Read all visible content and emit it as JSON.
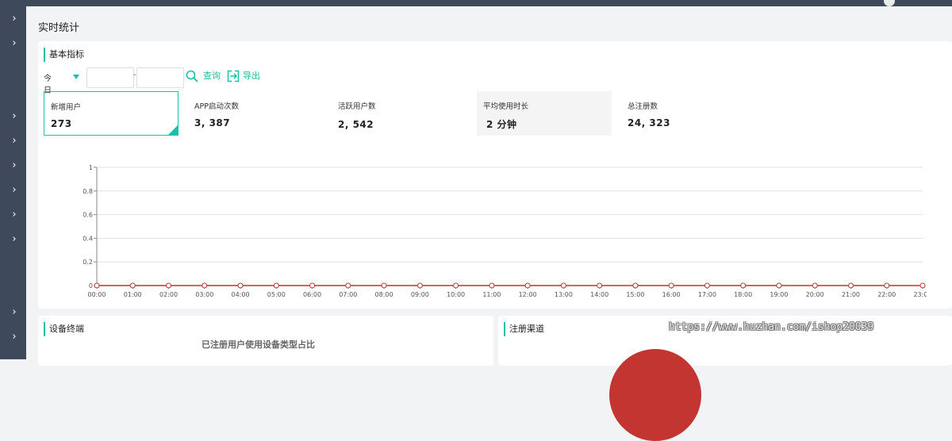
{
  "page_title": "实时统计",
  "basic_section": {
    "title": "基本指标",
    "filter": {
      "range_select": "今日",
      "start_date_value": "",
      "end_date_value": "",
      "separator": "-",
      "query_label": "查询",
      "export_label": "导出"
    },
    "metrics": [
      {
        "label": "新增用户",
        "value": "273",
        "state": "selected"
      },
      {
        "label": "APP启动次数",
        "value": "3, 387",
        "state": "normal"
      },
      {
        "label": "活跃用户数",
        "value": "2, 542",
        "state": "normal"
      },
      {
        "label": "平均使用时长",
        "value": "2 分钟",
        "state": "hover"
      },
      {
        "label": "总注册数",
        "value": "24, 323",
        "state": "normal"
      }
    ]
  },
  "chart_data": {
    "type": "line",
    "categories": [
      "00:00",
      "01:00",
      "02:00",
      "03:00",
      "04:00",
      "05:00",
      "06:00",
      "07:00",
      "08:00",
      "09:00",
      "10:00",
      "11:00",
      "12:00",
      "13:00",
      "14:00",
      "15:00",
      "16:00",
      "17:00",
      "18:00",
      "19:00",
      "20:00",
      "21:00",
      "22:00",
      "23:00"
    ],
    "series": [
      {
        "values": [
          0,
          0,
          0,
          0,
          0,
          0,
          0,
          0,
          0,
          0,
          0,
          0,
          0,
          0,
          0,
          0,
          0,
          0,
          0,
          0,
          0,
          0,
          0,
          0
        ],
        "color": "#c23531"
      }
    ],
    "y_ticks": [
      "0",
      "0.2",
      "0.4",
      "0.6",
      "0.8",
      "1"
    ],
    "ylim": [
      0,
      1
    ],
    "grid": "horizontal",
    "title": "",
    "xlabel": "",
    "ylabel": ""
  },
  "device_section": {
    "title": "设备终端",
    "chart_title": "已注册用户使用设备类型占比"
  },
  "channel_section": {
    "title": "注册渠道"
  },
  "watermark": "https://www.huzhan.com/ishop20039",
  "colors": {
    "accent": "#19c2a6",
    "sidebar": "#3e4a5b",
    "line": "#c23531",
    "pie": "#c23531"
  },
  "sidebar_icons": [
    "chevron-right-icon",
    "chevron-right-icon",
    "chevron-right-icon",
    "chevron-right-icon",
    "chevron-right-icon",
    "chevron-right-icon",
    "chevron-right-icon",
    "chevron-right-icon",
    "chevron-right-icon",
    "chevron-right-icon"
  ]
}
